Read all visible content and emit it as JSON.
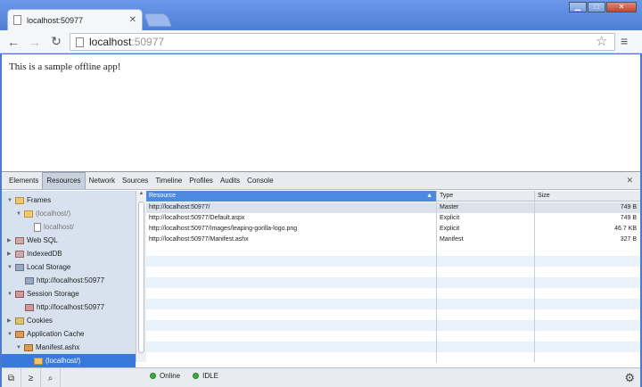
{
  "browser": {
    "tab_title": "localhost:50977",
    "url_host": "localhost",
    "url_port": ":50977",
    "window_buttons": [
      "▁",
      "□",
      "✕"
    ]
  },
  "page": {
    "text": "This is a sample offline app!"
  },
  "devtools": {
    "tabs": [
      "Elements",
      "Resources",
      "Network",
      "Sources",
      "Timeline",
      "Profiles",
      "Audits",
      "Console"
    ],
    "active_tab": "Resources",
    "sidebar": {
      "frames": "Frames",
      "frame_root": "(localhost/)",
      "frame_child": "localhost/",
      "web_sql": "Web SQL",
      "indexeddb": "IndexedDB",
      "local_storage": "Local Storage",
      "local_storage_item": "http://localhost:50977",
      "session_storage": "Session Storage",
      "session_storage_item": "http://localhost:50977",
      "cookies": "Cookies",
      "app_cache": "Application Cache",
      "manifest": "Manifest.ashx",
      "manifest_child": "(localhost/)"
    },
    "grid": {
      "columns": [
        "Resource",
        "Type",
        "Size"
      ],
      "rows": [
        {
          "resource": "http://localhost:50977/",
          "type": "Master",
          "size": "749 B"
        },
        {
          "resource": "http://localhost:50977/Default.aspx",
          "type": "Explicit",
          "size": "749 B"
        },
        {
          "resource": "http://localhost:50977/Images/leaping-gorilla-logo.png",
          "type": "Explicit",
          "size": "46.7 KB"
        },
        {
          "resource": "http://localhost:50977/Manifest.ashx",
          "type": "Manifest",
          "size": "327 B"
        }
      ]
    },
    "status": {
      "online": "Online",
      "idle": "IDLE"
    }
  },
  "colors": {
    "selection": "#3879d9",
    "chrome_blue": "#4f7fd6",
    "status_green": "#3cae3c"
  }
}
